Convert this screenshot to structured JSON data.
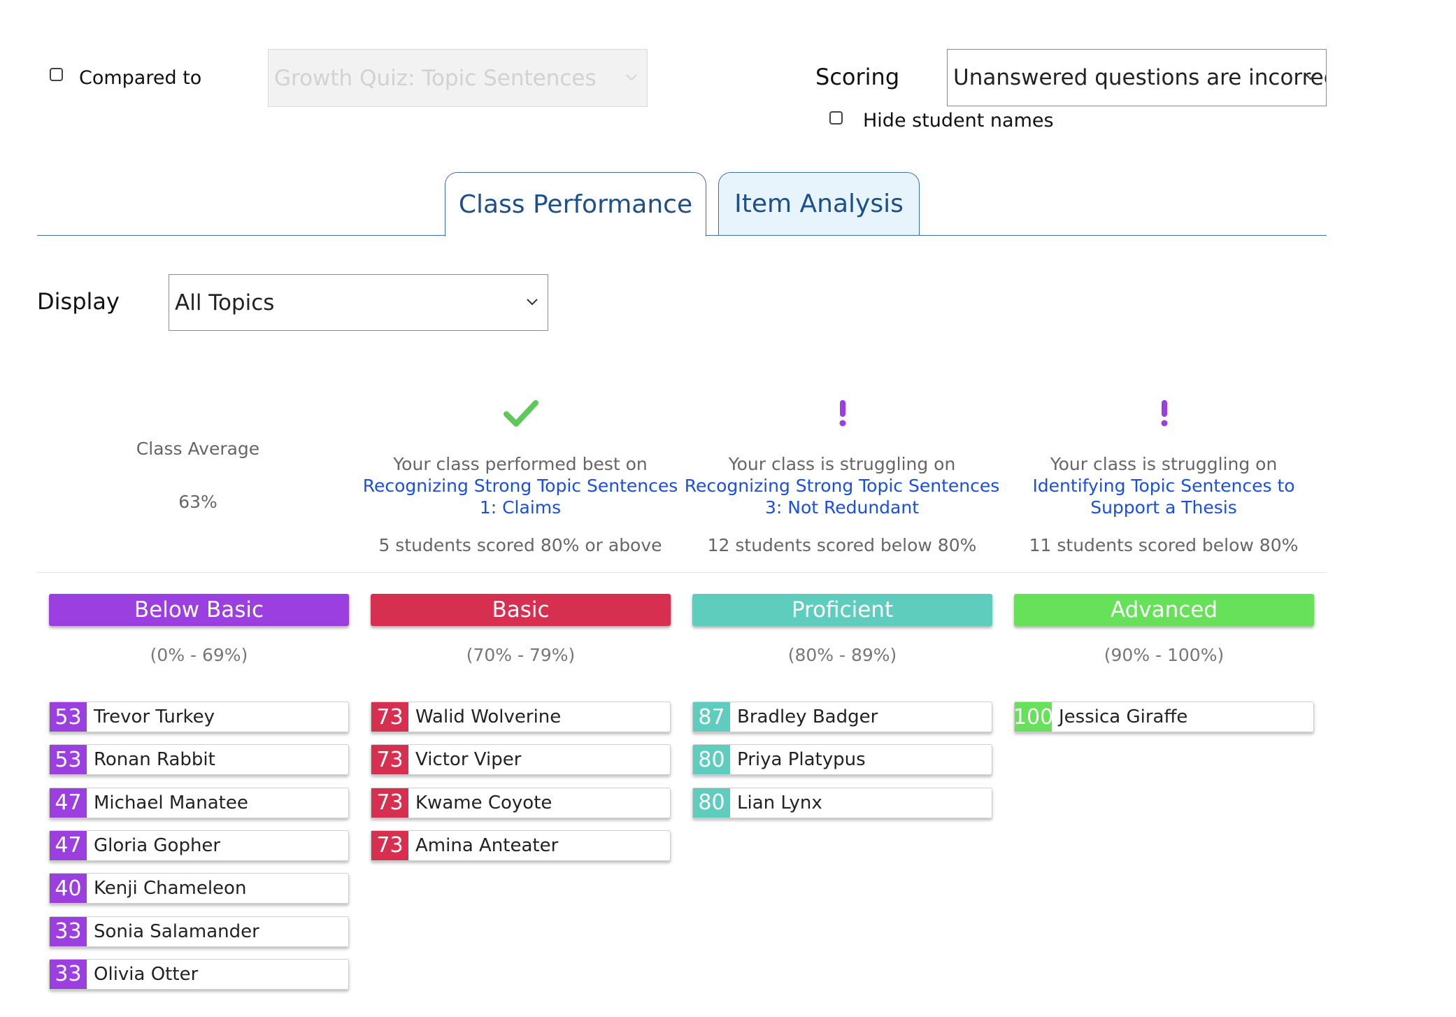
{
  "controls": {
    "compared_to_label": "Compared to",
    "compared_to_value": "Growth Quiz: Topic Sentences",
    "scoring_label": "Scoring",
    "scoring_value": "Unanswered questions are incorrect",
    "hide_names_label": "Hide student names"
  },
  "tabs": [
    {
      "label": "Class Performance",
      "active": true
    },
    {
      "label": "Item Analysis",
      "active": false
    }
  ],
  "display": {
    "label": "Display",
    "value": "All Topics"
  },
  "summary": {
    "class_average_label": "Class Average",
    "class_average_value": "63%",
    "cards": [
      {
        "icon": "checkmark-icon",
        "intro": "Your class performed best on",
        "topic": "Recognizing Strong Topic Sentences 1: Claims",
        "stat": "5 students scored 80% or above"
      },
      {
        "icon": "exclamation-icon",
        "intro": "Your class is struggling on",
        "topic": "Recognizing Strong Topic Sentences 3: Not Redundant",
        "stat": "12 students scored below 80%"
      },
      {
        "icon": "exclamation-icon",
        "intro": "Your class is struggling on",
        "topic": "Identifying Topic Sentences to Support a Thesis",
        "stat": "11 students scored below 80%"
      }
    ]
  },
  "colors": {
    "below_basic": "#9b3fe0",
    "basic": "#d62f50",
    "proficient": "#5fcdbd",
    "advanced": "#67e05a",
    "link": "#1b4fe0",
    "check": "#5cc95a",
    "exclaim": "#9b3fe0"
  },
  "levels": [
    {
      "name": "Below Basic",
      "range": "(0% - 69%)",
      "students": [
        {
          "score": "53",
          "name": "Trevor Turkey"
        },
        {
          "score": "53",
          "name": "Ronan Rabbit"
        },
        {
          "score": "47",
          "name": "Michael Manatee"
        },
        {
          "score": "47",
          "name": "Gloria Gopher"
        },
        {
          "score": "40",
          "name": "Kenji Chameleon"
        },
        {
          "score": "33",
          "name": "Sonia Salamander"
        },
        {
          "score": "33",
          "name": "Olivia Otter"
        }
      ]
    },
    {
      "name": "Basic",
      "range": "(70% - 79%)",
      "students": [
        {
          "score": "73",
          "name": "Walid Wolverine"
        },
        {
          "score": "73",
          "name": "Victor Viper"
        },
        {
          "score": "73",
          "name": "Kwame Coyote"
        },
        {
          "score": "73",
          "name": "Amina Anteater"
        }
      ]
    },
    {
      "name": "Proficient",
      "range": "(80% - 89%)",
      "students": [
        {
          "score": "87",
          "name": "Bradley Badger"
        },
        {
          "score": "80",
          "name": "Priya Platypus"
        },
        {
          "score": "80",
          "name": "Lian Lynx"
        }
      ]
    },
    {
      "name": "Advanced",
      "range": "(90% - 100%)",
      "students": [
        {
          "score": "100",
          "name": "Jessica Giraffe"
        }
      ]
    }
  ]
}
